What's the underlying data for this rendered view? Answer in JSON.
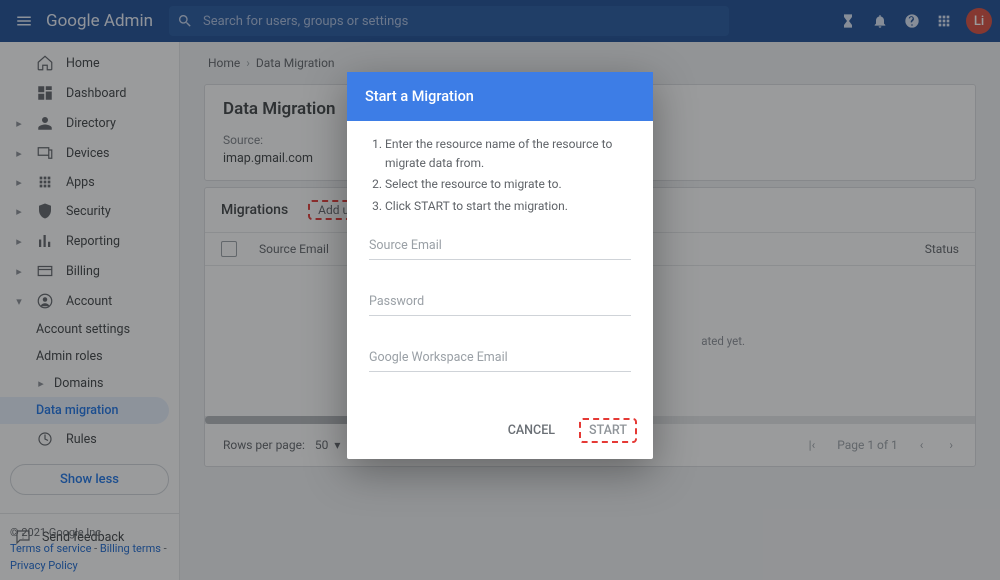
{
  "topbar": {
    "brand": "Google Admin",
    "search_placeholder": "Search for users, groups or settings",
    "avatar_initial": "Li"
  },
  "sidebar": {
    "items": [
      {
        "label": "Home"
      },
      {
        "label": "Dashboard"
      },
      {
        "label": "Directory"
      },
      {
        "label": "Devices"
      },
      {
        "label": "Apps"
      },
      {
        "label": "Security"
      },
      {
        "label": "Reporting"
      },
      {
        "label": "Billing"
      },
      {
        "label": "Account"
      },
      {
        "label": "Account settings"
      },
      {
        "label": "Admin roles"
      },
      {
        "label": "Domains"
      },
      {
        "label": "Data migration"
      },
      {
        "label": "Rules"
      }
    ],
    "show_less": "Show less",
    "feedback": "Send feedback",
    "footer": {
      "copyright": "© 2021 Google Inc.",
      "tos": "Terms of service",
      "billing": "Billing terms",
      "privacy": "Privacy Policy",
      "dash": " - "
    }
  },
  "breadcrumb": {
    "home": "Home",
    "current": "Data Migration"
  },
  "header_card": {
    "title": "Data Migration",
    "source_label": "Source:",
    "source_value": "imap.gmail.com"
  },
  "table": {
    "section_title": "Migrations",
    "add_user": "Add user",
    "col_source": "Source Email",
    "col_status": "Status",
    "empty_suffix": "ated yet."
  },
  "pager": {
    "rows_label": "Rows per page:",
    "rows_value": "50",
    "page_text": "Page 1 of 1"
  },
  "modal": {
    "title": "Start a Migration",
    "steps": [
      "Enter the resource name of the resource to migrate data from.",
      "Select the resource to migrate to.",
      "Click START to start the migration."
    ],
    "ph_source": "Source Email",
    "ph_password": "Password",
    "ph_gwe": "Google Workspace Email",
    "cancel": "CANCEL",
    "start": "START"
  }
}
